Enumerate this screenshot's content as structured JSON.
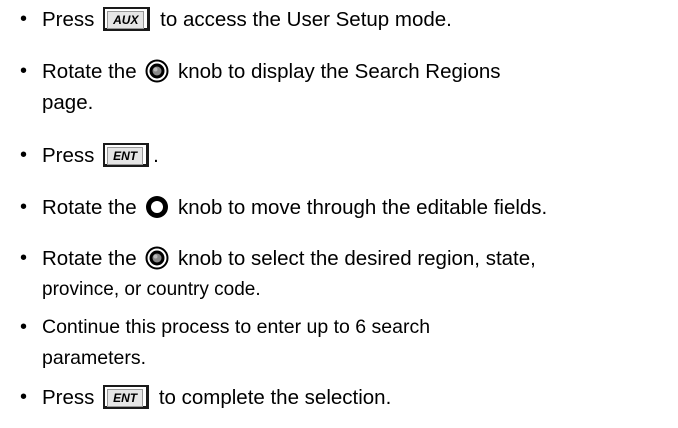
{
  "bullet_char": "•",
  "keys": {
    "aux": "AUX",
    "ent": "ENT"
  },
  "icons": {
    "inner_knob": "inner-knob-icon",
    "outer_knob": "outer-knob-icon"
  },
  "steps": [
    {
      "before": "Press",
      "after": "to access the User Setup mode."
    },
    {
      "before": "Rotate the",
      "after": "knob to display the Search Regions",
      "line2": "page."
    },
    {
      "before": "Press",
      "after": "."
    },
    {
      "before": "Rotate the",
      "after": "knob to move through the editable fields."
    },
    {
      "before": "Rotate the",
      "after": "knob to select the desired region, state,",
      "line2": "province, or country code."
    },
    {
      "line1": "Continue this process to enter up to 6 search",
      "line2": "parameters."
    },
    {
      "before": "Press",
      "after": "to complete the selection."
    }
  ]
}
